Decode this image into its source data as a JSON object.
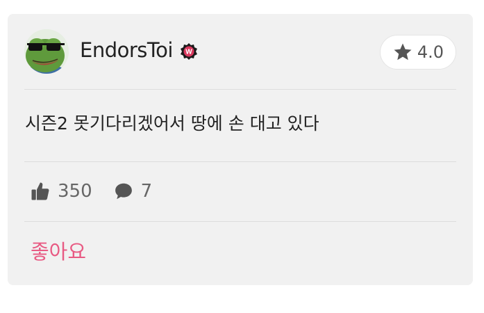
{
  "post": {
    "author": "EndorsToi",
    "badge_letter": "W",
    "rating": "4.0",
    "content": "시즌2 못기다리겠어서 땅에 손 대고 있다",
    "likes": "350",
    "comments": "7",
    "like_action_label": "좋아요"
  },
  "icons": {
    "avatar": "pepe-frog-sunglasses-avatar",
    "badge": "verified-w-badge",
    "rating": "star-icon",
    "likes": "thumbs-up-icon",
    "comments": "speech-bubble-icon"
  },
  "colors": {
    "card_background": "#f1f1f1",
    "accent": "#e85a83",
    "badge": "#d9385e",
    "icon_gray": "#555555"
  }
}
